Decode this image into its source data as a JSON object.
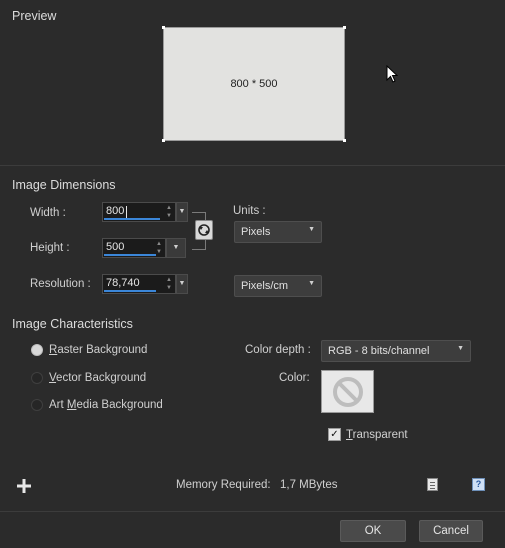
{
  "preview": {
    "title": "Preview",
    "label": "800 * 500"
  },
  "dimensions": {
    "title": "Image Dimensions",
    "width_label": "Width :",
    "width_value": "800",
    "height_label": "Height :",
    "height_value": "500",
    "resolution_label": "Resolution :",
    "resolution_value": "78,740",
    "units_label": "Units :",
    "units_value": "Pixels",
    "resolution_units_value": "Pixels/cm"
  },
  "characteristics": {
    "title": "Image Characteristics",
    "options": [
      {
        "first": "R",
        "rest": "aster Background",
        "selected": true
      },
      {
        "first": "V",
        "rest": "ector Background",
        "selected": false
      },
      {
        "pre": "Art ",
        "first": "M",
        "rest": "edia Background",
        "selected": false
      }
    ],
    "color_depth_label": "Color depth :",
    "color_depth_value": "RGB - 8 bits/channel",
    "color_label": "Color:",
    "transparent_first": "T",
    "transparent_rest": "ransparent",
    "transparent_checked": true
  },
  "footer": {
    "memory_label": "Memory Required:",
    "memory_value": "1,7 MBytes",
    "ok_label": "OK",
    "cancel_label": "Cancel"
  },
  "colors": {
    "accent": "#3b86d8",
    "bg": "#2b2b2b"
  }
}
